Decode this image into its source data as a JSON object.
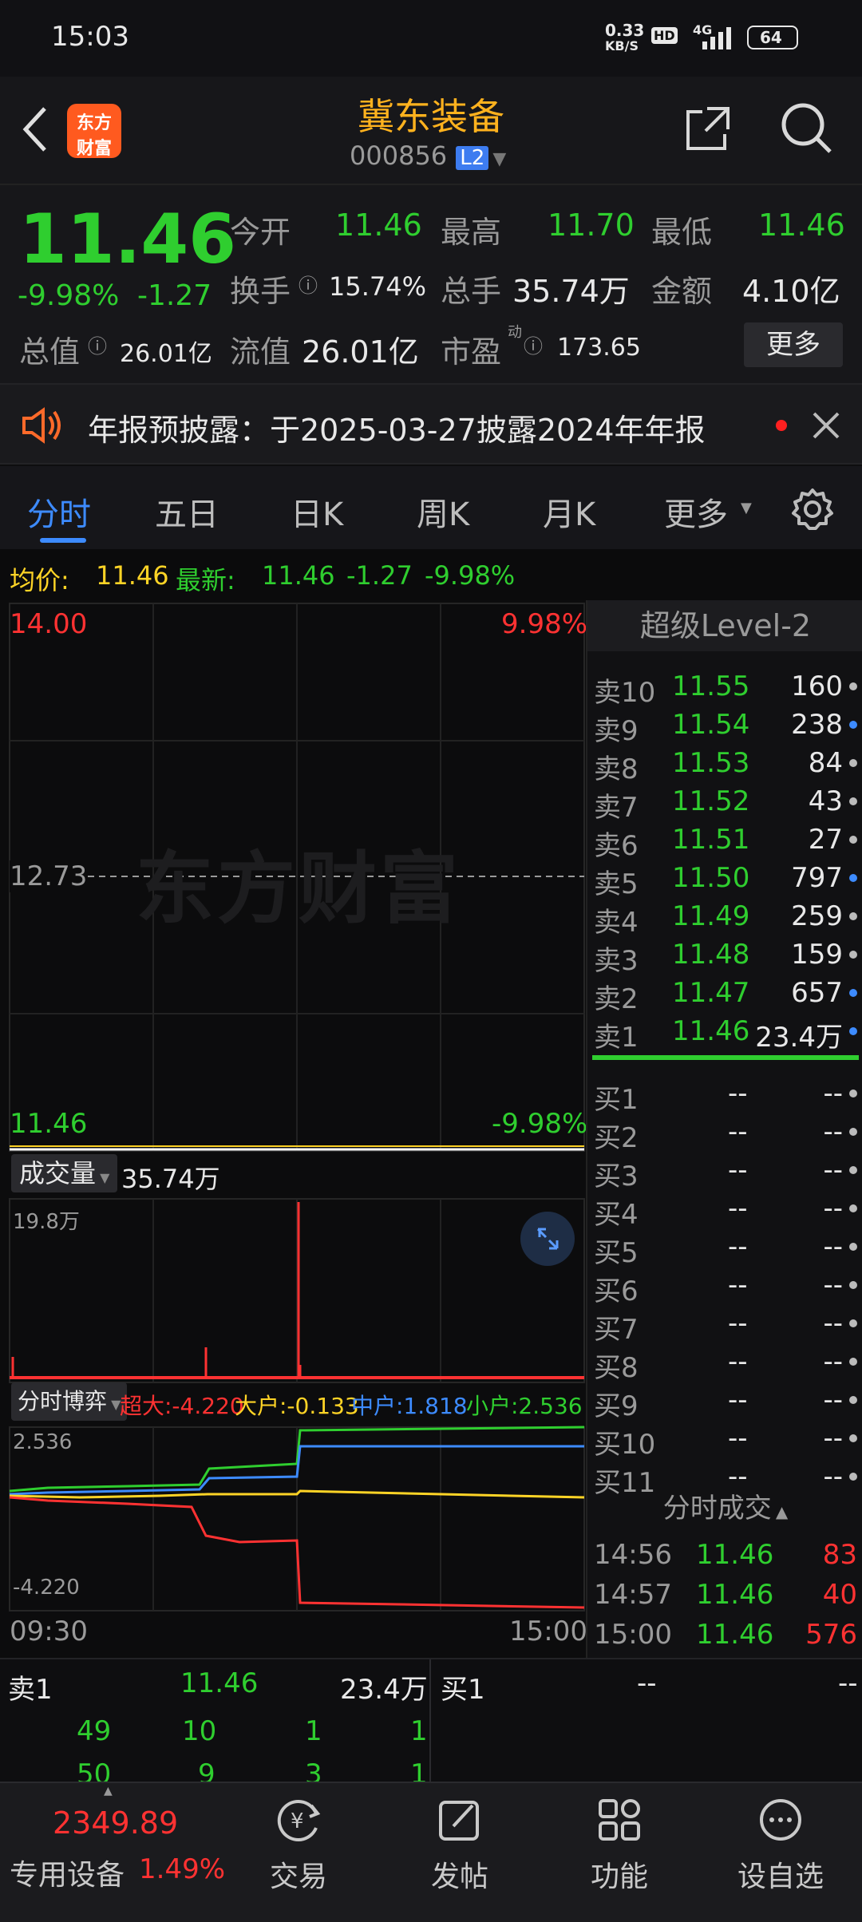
{
  "status_bar": {
    "time": "15:03",
    "net_speed": "0.33",
    "net_unit": "KB/S",
    "hd": "HD",
    "network": "4G",
    "battery": "64"
  },
  "header": {
    "logo_line1": "东方",
    "logo_line2": "财富",
    "stock_name": "冀东装备",
    "stock_code": "000856",
    "level_badge": "L2"
  },
  "quote": {
    "price": "11.46",
    "change_pct": "-9.98%",
    "change": "-1.27",
    "open_label": "今开",
    "open": "11.46",
    "high_label": "最高",
    "high": "11.70",
    "low_label": "最低",
    "low": "11.46",
    "turnover_label": "换手",
    "turnover": "15.74%",
    "volume_label": "总手",
    "volume": "35.74万",
    "amount_label": "金额",
    "amount": "4.10亿",
    "mktcap_label": "总值",
    "mktcap": "26.01亿",
    "float_label": "流值",
    "float": "26.01亿",
    "pe_label": "市盈",
    "pe_sup": "动",
    "pe": "173.65",
    "more_button": "更多"
  },
  "notice": {
    "text": "年报预披露：于2025-03-27披露2024年年报"
  },
  "tabs": [
    "分时",
    "五日",
    "日K",
    "周K",
    "月K",
    "更多"
  ],
  "infoline": {
    "avg_label": "均价:",
    "avg": "11.46",
    "latest_label": "最新:",
    "latest": "11.46",
    "change": "-1.27",
    "change_pct": "-9.98%"
  },
  "chart": {
    "price_top": "14.00",
    "pct_top": "9.98%",
    "price_mid": "12.73",
    "watermark": "东方财富",
    "price_bottom": "11.46",
    "pct_bottom": "-9.98%",
    "volume_label": "成交量",
    "volume_value": "35.74万",
    "volume_max": "19.8万",
    "flow_label": "分时博弈",
    "flow_super": "超大:-4.220",
    "flow_big": "大户:-0.133",
    "flow_mid": "中户:1.818",
    "flow_small": "小户:2.536",
    "flow_max": "2.536",
    "flow_min": "-4.220",
    "time_start": "09:30",
    "time_end": "15:00",
    "colors": {
      "super": "#ff3232",
      "big": "#ffd426",
      "mid": "#3d8bff",
      "small": "#2fce2f"
    }
  },
  "orderbook": {
    "title": "超级Level-2",
    "asks": [
      {
        "label": "卖10",
        "price": "11.55",
        "vol": "160",
        "dot": "gray"
      },
      {
        "label": "卖9",
        "price": "11.54",
        "vol": "238",
        "dot": "blue"
      },
      {
        "label": "卖8",
        "price": "11.53",
        "vol": "84",
        "dot": "gray"
      },
      {
        "label": "卖7",
        "price": "11.52",
        "vol": "43",
        "dot": "gray"
      },
      {
        "label": "卖6",
        "price": "11.51",
        "vol": "27",
        "dot": "gray"
      },
      {
        "label": "卖5",
        "price": "11.50",
        "vol": "797",
        "dot": "blue"
      },
      {
        "label": "卖4",
        "price": "11.49",
        "vol": "259",
        "dot": "gray"
      },
      {
        "label": "卖3",
        "price": "11.48",
        "vol": "159",
        "dot": "gray"
      },
      {
        "label": "卖2",
        "price": "11.47",
        "vol": "657",
        "dot": "blue"
      },
      {
        "label": "卖1",
        "price": "11.46",
        "vol": "23.4万",
        "dot": "blue"
      }
    ],
    "bids": [
      {
        "label": "买1",
        "price": "--",
        "vol": "--"
      },
      {
        "label": "买2",
        "price": "--",
        "vol": "--"
      },
      {
        "label": "买3",
        "price": "--",
        "vol": "--"
      },
      {
        "label": "买4",
        "price": "--",
        "vol": "--"
      },
      {
        "label": "买5",
        "price": "--",
        "vol": "--"
      },
      {
        "label": "买6",
        "price": "--",
        "vol": "--"
      },
      {
        "label": "买7",
        "price": "--",
        "vol": "--"
      },
      {
        "label": "买8",
        "price": "--",
        "vol": "--"
      },
      {
        "label": "买9",
        "price": "--",
        "vol": "--"
      },
      {
        "label": "买10",
        "price": "--",
        "vol": "--"
      },
      {
        "label": "买11",
        "price": "--",
        "vol": "--"
      }
    ],
    "trades_title": "分时成交",
    "trades": [
      {
        "time": "14:56",
        "price": "11.46",
        "vol": "83"
      },
      {
        "time": "14:57",
        "price": "11.46",
        "vol": "40"
      },
      {
        "time": "15:00",
        "price": "11.46",
        "vol": "576"
      }
    ]
  },
  "bottom_quote": {
    "ask_label": "卖1",
    "ask_price": "11.46",
    "ask_vol": "23.4万",
    "bid_label": "买1",
    "bid_price": "--",
    "bid_vol": "--",
    "row1": [
      "49",
      "10",
      "1",
      "1"
    ],
    "row2": [
      "50",
      "9",
      "3",
      "1"
    ]
  },
  "bottom_nav": {
    "index_value": "2349.89",
    "device_label": "专用设备",
    "device_pct": "1.49%",
    "trade": "交易",
    "post": "发帖",
    "func": "功能",
    "watch": "设自选"
  }
}
